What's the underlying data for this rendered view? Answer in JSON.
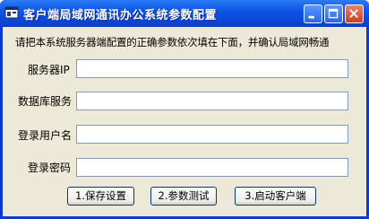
{
  "window": {
    "title": "客户端局域网通讯办公系统参数配置",
    "icon": "app-window-icon",
    "controls": [
      "minimize-icon",
      "maximize-icon",
      "close-icon"
    ]
  },
  "prompt": "请把本系统服务器端配置的正确参数依次填在下面，并确认局域网畅通",
  "fields": [
    {
      "label": "服务器IP",
      "value": ""
    },
    {
      "label": "数据库服务",
      "value": ""
    },
    {
      "label": "登录用户名",
      "value": ""
    },
    {
      "label": "登录密码",
      "value": ""
    }
  ],
  "buttons": {
    "save": "1.保存设置",
    "test": "2.参数测试",
    "launch": "3.启动客户端"
  },
  "colors": {
    "titlebar": "#0a48d6",
    "client_bg": "#ece9d8",
    "close_button": "#c7401f"
  }
}
